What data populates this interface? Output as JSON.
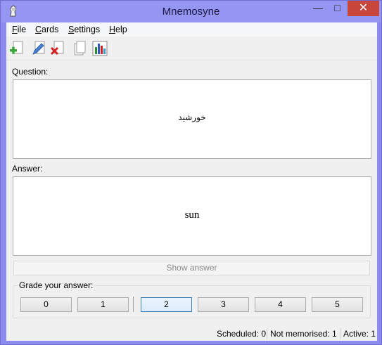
{
  "window": {
    "title": "Mnemosyne"
  },
  "menu": [
    {
      "label": "File",
      "accel": "F",
      "rest": "ile"
    },
    {
      "label": "Cards",
      "accel": "C",
      "rest": "ards"
    },
    {
      "label": "Settings",
      "accel": "S",
      "rest": "ettings"
    },
    {
      "label": "Help",
      "accel": "H",
      "rest": "elp"
    }
  ],
  "toolbar": {
    "icons": [
      "add-card-icon",
      "edit-card-icon",
      "delete-card-icon",
      "browse-cards-icon",
      "statistics-icon"
    ]
  },
  "question": {
    "label": "Question:",
    "text": "خورشيد"
  },
  "answer": {
    "label": "Answer:",
    "text": "sun"
  },
  "show_answer": {
    "label": "Show answer",
    "enabled": false
  },
  "grades": {
    "legend": "Grade your answer:",
    "buttons": [
      "0",
      "1",
      "2",
      "3",
      "4",
      "5"
    ],
    "focused": "2"
  },
  "status": {
    "scheduled": "Scheduled: 0",
    "not_memorised": "Not memorised: 1",
    "active": "Active: 1"
  },
  "colors": {
    "titlebar": "#9595f2",
    "close_button": "#c7453a",
    "focus_border": "#3c7fb1"
  }
}
